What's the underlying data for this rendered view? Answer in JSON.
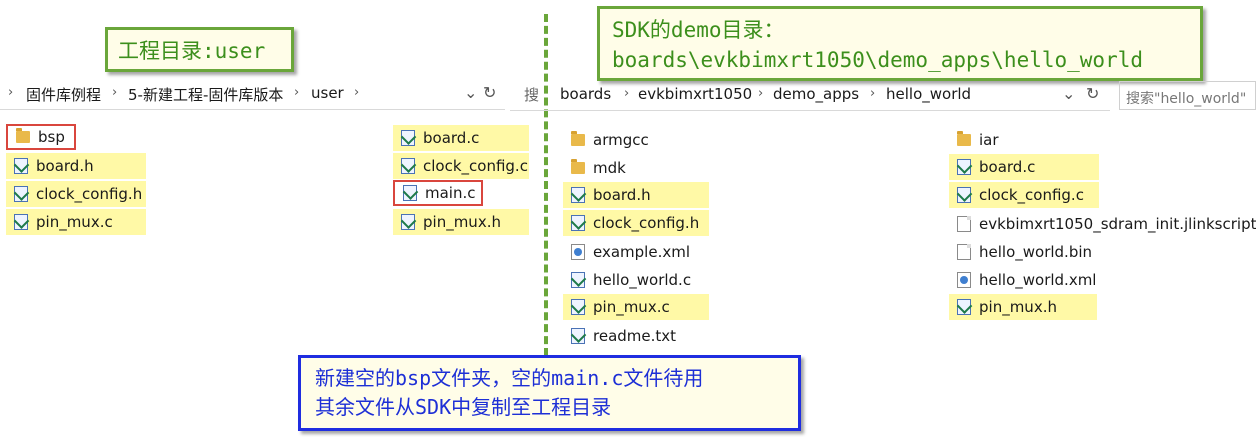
{
  "callouts": {
    "user_dir": "工程目录:user",
    "sdk_line1": "SDK的demo目录：",
    "sdk_line2": "boards\\evkbimxrt1050\\demo_apps\\hello_world",
    "note_line1": "新建空的bsp文件夹，空的main.c文件待用",
    "note_line2": "其余文件从SDK中复制至工程目录"
  },
  "left_window": {
    "breadcrumb": [
      "固件库例程",
      "5-新建工程-固件库版本",
      "user"
    ],
    "files_col1": [
      {
        "name": "bsp",
        "icon": "folder-icon",
        "style": "red"
      },
      {
        "name": "board.h",
        "icon": "c-file-icon",
        "style": "highlight"
      },
      {
        "name": "clock_config.h",
        "icon": "c-file-icon",
        "style": "highlight"
      },
      {
        "name": "pin_mux.c",
        "icon": "c-file-icon",
        "style": "highlight"
      }
    ],
    "files_col2": [
      {
        "name": "board.c",
        "icon": "c-file-icon",
        "style": "highlight"
      },
      {
        "name": "clock_config.c",
        "icon": "c-file-icon",
        "style": "highlight"
      },
      {
        "name": "main.c",
        "icon": "c-file-icon",
        "style": "red"
      },
      {
        "name": "pin_mux.h",
        "icon": "c-file-icon",
        "style": "highlight"
      }
    ]
  },
  "right_window": {
    "search_stub": "搜",
    "breadcrumb": [
      "boards",
      "evkbimxrt1050",
      "demo_apps",
      "hello_world"
    ],
    "search_placeholder": "搜索\"hello_world\"",
    "files_col1": [
      {
        "name": "armgcc",
        "icon": "folder-icon",
        "style": "plain"
      },
      {
        "name": "mdk",
        "icon": "folder-icon",
        "style": "plain"
      },
      {
        "name": "board.h",
        "icon": "c-file-icon",
        "style": "highlight"
      },
      {
        "name": "clock_config.h",
        "icon": "c-file-icon",
        "style": "highlight"
      },
      {
        "name": "example.xml",
        "icon": "xml-file-icon",
        "style": "plain"
      },
      {
        "name": "hello_world.c",
        "icon": "c-file-icon",
        "style": "plain"
      },
      {
        "name": "pin_mux.c",
        "icon": "c-file-icon",
        "style": "highlight"
      },
      {
        "name": "readme.txt",
        "icon": "c-file-icon",
        "style": "plain"
      }
    ],
    "files_col2": [
      {
        "name": "iar",
        "icon": "folder-icon",
        "style": "plain"
      },
      {
        "name": "board.c",
        "icon": "c-file-icon",
        "style": "highlight"
      },
      {
        "name": "clock_config.c",
        "icon": "c-file-icon",
        "style": "highlight"
      },
      {
        "name": "evkbimxrt1050_sdram_init.jlinkscript",
        "icon": "doc-file-icon",
        "style": "plain"
      },
      {
        "name": "hello_world.bin",
        "icon": "doc-file-icon",
        "style": "plain"
      },
      {
        "name": "hello_world.xml",
        "icon": "xml-file-icon",
        "style": "plain"
      },
      {
        "name": "pin_mux.h",
        "icon": "c-file-icon",
        "style": "highlight"
      }
    ]
  }
}
